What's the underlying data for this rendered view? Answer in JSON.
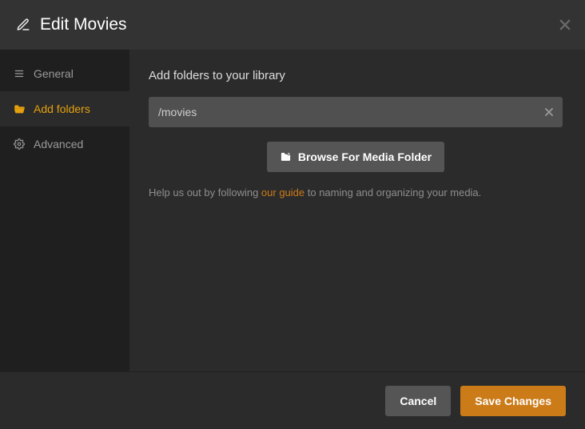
{
  "header": {
    "title": "Edit Movies"
  },
  "sidebar": {
    "items": [
      {
        "label": "General"
      },
      {
        "label": "Add folders"
      },
      {
        "label": "Advanced"
      }
    ]
  },
  "content": {
    "section_title": "Add folders to your library",
    "folder_path": "/movies",
    "browse_label": "Browse For Media Folder",
    "help_prefix": "Help us out by following ",
    "help_link": "our guide",
    "help_suffix": " to naming and organizing your media."
  },
  "footer": {
    "cancel_label": "Cancel",
    "save_label": "Save Changes"
  },
  "colors": {
    "accent": "#cc7b19",
    "active": "#e5a00d"
  }
}
